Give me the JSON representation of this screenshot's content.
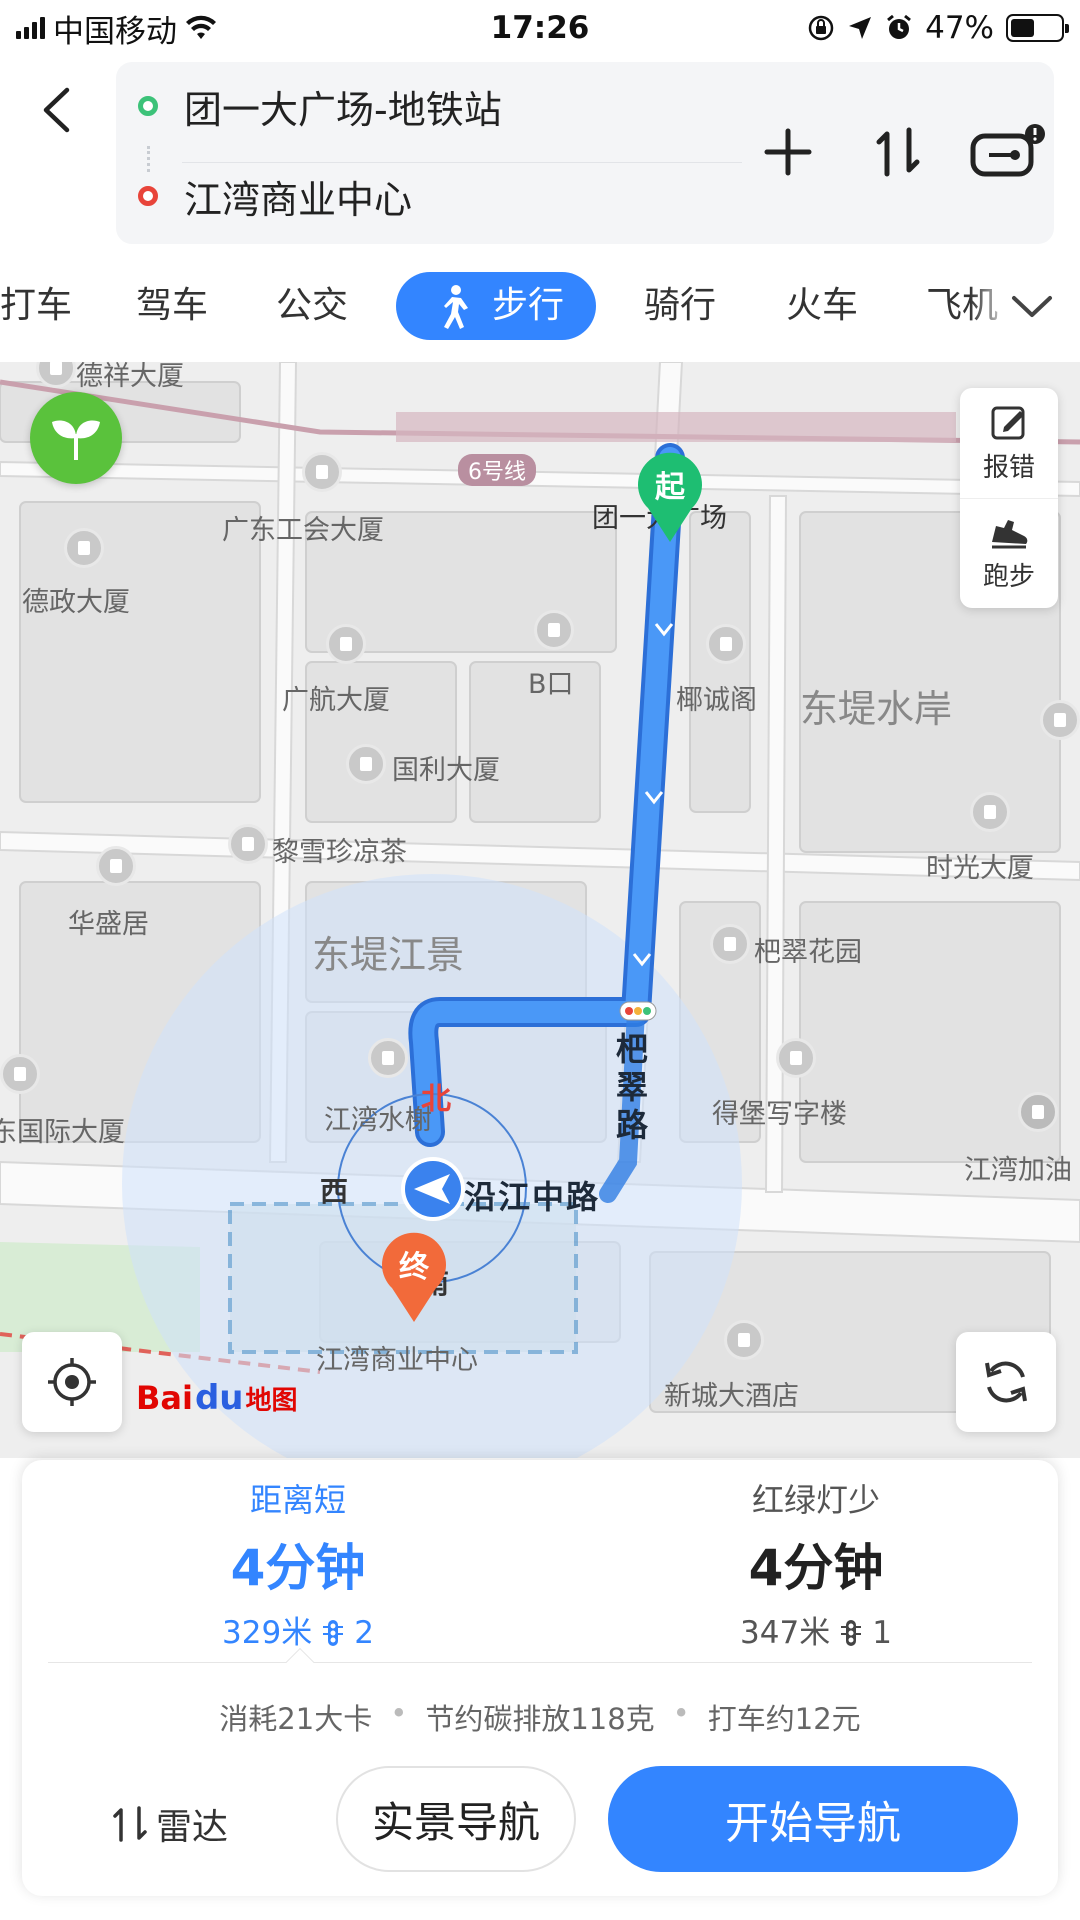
{
  "status_bar": {
    "carrier": "中国移动",
    "time": "17:26",
    "battery": "47%",
    "battery_level": 0.47
  },
  "route": {
    "start": "团一大广场-地铁站",
    "end": "江湾商业中心",
    "icons": [
      "back-icon",
      "add-waypoint-icon",
      "swap-icon",
      "vr-icon"
    ]
  },
  "modes": {
    "items": [
      "打车",
      "驾车",
      "公交",
      "步行",
      "骑行",
      "火车",
      "飞机"
    ],
    "active": "步行"
  },
  "map": {
    "labels": {
      "dexiang": "德祥大厦",
      "gonghui": "广东工会大厦",
      "dezheng": "德政大厦",
      "guanghang": "广航大厦",
      "bkou": "B口",
      "yecheng": "椰诚阁",
      "dongdi_shuian": "东堤水岸",
      "guoli": "国利大厦",
      "lixuezhen": "黎雪珍凉茶",
      "huasheng": "华盛居",
      "shiguang": "时光大厦",
      "dongdi_jiangjing": "东堤江景",
      "bacui_huayuan": "杷翠花园",
      "jiangwan_shuixie": "江湾水榭",
      "debao": "得堡写字楼",
      "intl": "东国际大厦",
      "jiangwan_gas": "江湾加油",
      "jiangwan_center": "江湾商业中心",
      "xincheng": "新城大酒店",
      "tuanyi": "团一大广场",
      "line6": "6号线",
      "road_v": "杷翠路",
      "road_h": "沿江中路"
    },
    "pins": {
      "start": "起",
      "end": "终"
    },
    "compass": {
      "north": "北",
      "west": "西",
      "south": "南"
    },
    "side_buttons": {
      "report": "报错",
      "run": "跑步"
    },
    "logo": {
      "bai": "Bai",
      "du": "du",
      "cn": "地图"
    }
  },
  "plans": [
    {
      "tag": "距离短",
      "time": "4分钟",
      "distance": "329米",
      "lights": "2"
    },
    {
      "tag": "红绿灯少",
      "time": "4分钟",
      "distance": "347米",
      "lights": "1"
    }
  ],
  "eco": {
    "calories": "消耗21大卡",
    "carbon": "节约碳排放118克",
    "taxi": "打车约12元"
  },
  "actions": {
    "radar": "雷达",
    "ar_nav": "实景导航",
    "start_nav": "开始导航"
  },
  "colors": {
    "accent": "#3385ff",
    "route": "#3e8ef7",
    "start_pin": "#1ebe72",
    "end_pin": "#f26a3a"
  }
}
